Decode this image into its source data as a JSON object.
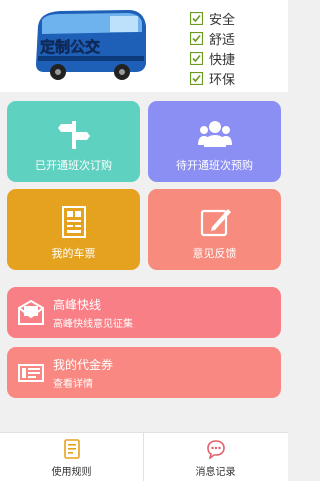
{
  "banner": {
    "bus_title": "定制公交",
    "features": [
      "安全",
      "舒适",
      "快捷",
      "环保"
    ]
  },
  "tiles": [
    {
      "label": "已开通班次订购",
      "icon": "signpost-icon"
    },
    {
      "label": "待开通班次预购",
      "icon": "group-icon"
    },
    {
      "label": "我的车票",
      "icon": "ticket-icon"
    },
    {
      "label": "意见反馈",
      "icon": "edit-icon"
    }
  ],
  "wide": [
    {
      "title": "高峰快线",
      "subtitle": "高峰快线意见征集",
      "icon": "mail-icon"
    },
    {
      "title": "我的代金券",
      "subtitle": "查看详情",
      "icon": "voucher-icon"
    }
  ],
  "bottom": {
    "rules_label": "使用规则",
    "messages_label": "消息记录"
  },
  "colors": {
    "teal": "#5ed1c0",
    "purple": "#8b8ef3",
    "orange": "#e5a21f",
    "salmon": "#f78b7d",
    "pink": "#f97f86",
    "coral": "#fa8882",
    "accent_tab": "#e5a21f",
    "msg_tab": "#e2626e"
  }
}
